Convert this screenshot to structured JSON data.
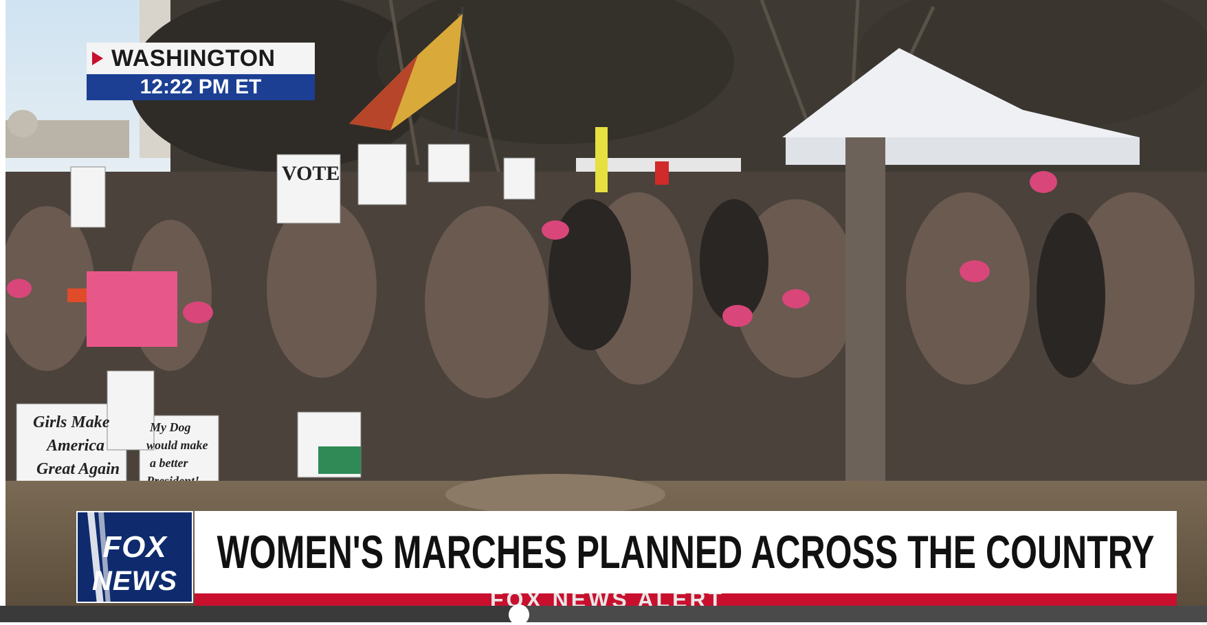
{
  "video": {
    "location_bug": {
      "city": "WASHINGTON",
      "time": "12:22 PM ET"
    },
    "channel_logo": {
      "line1": "FOX",
      "line2": "NEWS"
    },
    "headline": "WOMEN'S MARCHES PLANNED ACROSS THE COUNTRY",
    "alert_bar": "FOX NEWS ALERT",
    "scene_signs": {
      "vote": "VOTE",
      "girls": [
        "Girls Make",
        "America",
        "Great Again"
      ],
      "dog": [
        "My Dog",
        "would make",
        "a better",
        "President!"
      ]
    }
  },
  "player": {
    "progress_fraction": 0.43
  },
  "colors": {
    "fox_blue": "#1c3f94",
    "fox_red": "#c8102e",
    "logo_navy": "#0f2b6e"
  }
}
